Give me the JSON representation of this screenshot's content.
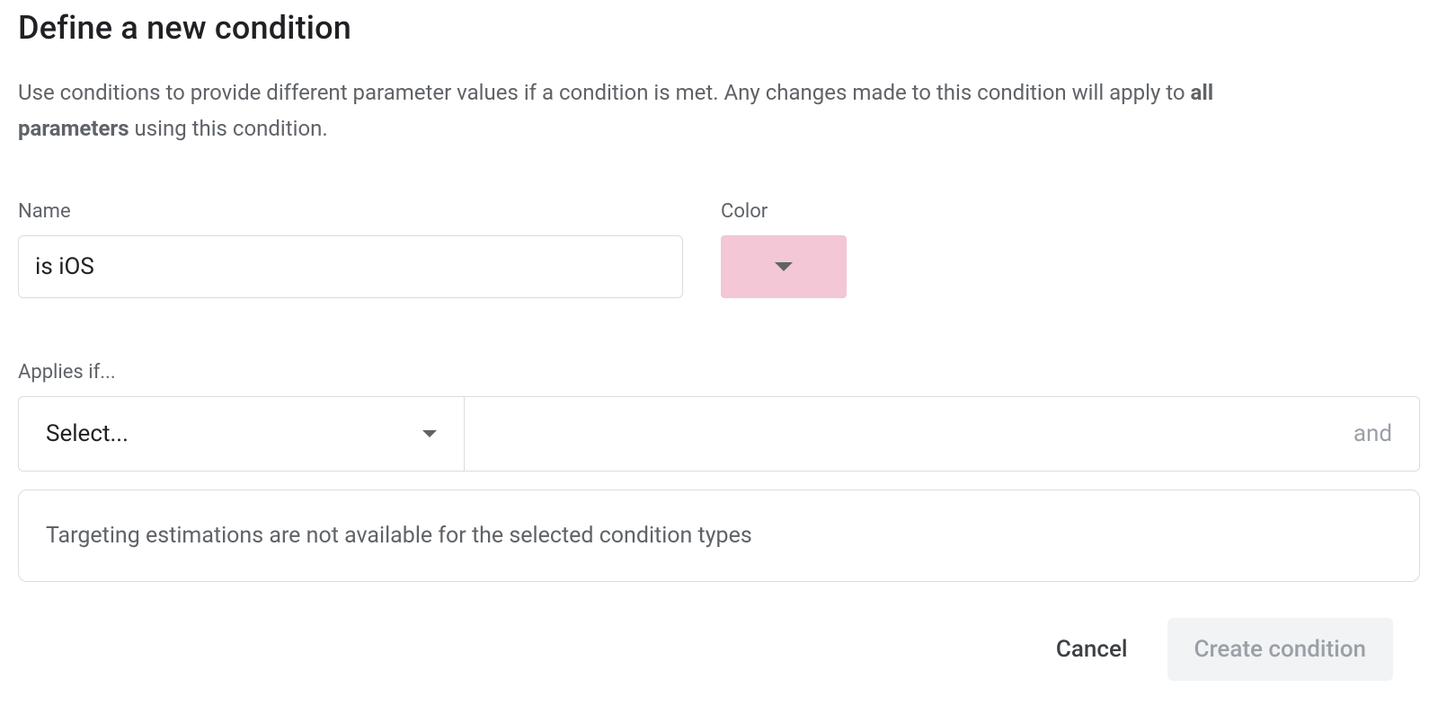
{
  "title": "Define a new condition",
  "description": {
    "part1": "Use conditions to provide different parameter values if a condition is met. Any changes made to this condition will apply to ",
    "bold": "all parameters",
    "part2": " using this condition."
  },
  "labels": {
    "name": "Name",
    "color": "Color",
    "applies_if": "Applies if..."
  },
  "fields": {
    "name_value": "is iOS",
    "select_placeholder": "Select...",
    "and_label": "and"
  },
  "info_message": "Targeting estimations are not available for the selected condition types",
  "buttons": {
    "cancel": "Cancel",
    "create": "Create condition"
  },
  "colors": {
    "selected_color": "#f3c7d5"
  }
}
